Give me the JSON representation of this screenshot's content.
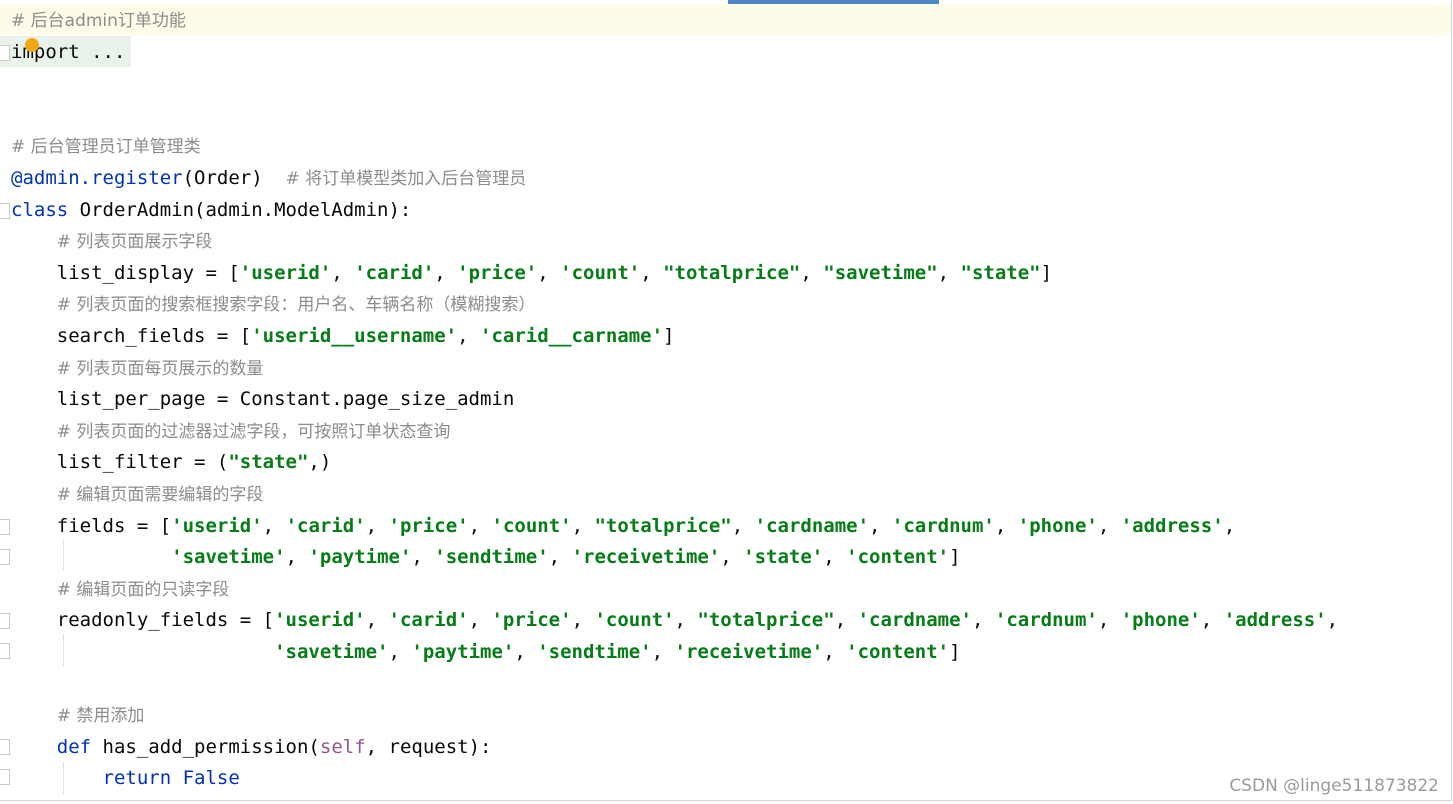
{
  "editor": {
    "lines": [
      {
        "segments": [
          {
            "t": "# 后台admin订单功能",
            "c": "cm-cjk"
          }
        ]
      },
      {
        "segments": [
          {
            "t": "import ...",
            "c": ""
          }
        ]
      },
      {
        "segments": []
      },
      {
        "segments": []
      },
      {
        "segments": [
          {
            "t": "# 后台管理员订单管理类",
            "c": "cm-cjk"
          }
        ]
      },
      {
        "segments": [
          {
            "t": "@admin.register",
            "c": "deco"
          },
          {
            "t": "(Order)  ",
            "c": ""
          },
          {
            "t": "# 将订单模型类加入后台管理员",
            "c": "cm-cjk"
          }
        ]
      },
      {
        "segments": [
          {
            "t": "class",
            "c": "kw"
          },
          {
            "t": " OrderAdmin(admin.ModelAdmin):",
            "c": ""
          }
        ]
      },
      {
        "segments": [
          {
            "t": "    ",
            "c": ""
          },
          {
            "t": "# 列表页面展示字段",
            "c": "cm-cjk"
          }
        ]
      },
      {
        "segments": [
          {
            "t": "    list_display = [",
            "c": ""
          },
          {
            "t": "'userid'",
            "c": "str"
          },
          {
            "t": ", ",
            "c": ""
          },
          {
            "t": "'carid'",
            "c": "str"
          },
          {
            "t": ", ",
            "c": ""
          },
          {
            "t": "'price'",
            "c": "str"
          },
          {
            "t": ", ",
            "c": ""
          },
          {
            "t": "'count'",
            "c": "str"
          },
          {
            "t": ", ",
            "c": ""
          },
          {
            "t": "\"totalprice\"",
            "c": "str"
          },
          {
            "t": ", ",
            "c": ""
          },
          {
            "t": "\"savetime\"",
            "c": "str"
          },
          {
            "t": ", ",
            "c": ""
          },
          {
            "t": "\"state\"",
            "c": "str"
          },
          {
            "t": "]",
            "c": ""
          }
        ]
      },
      {
        "segments": [
          {
            "t": "    ",
            "c": ""
          },
          {
            "t": "# 列表页面的搜索框搜索字段：用户名、车辆名称（模糊搜索）",
            "c": "cm-cjk"
          }
        ]
      },
      {
        "segments": [
          {
            "t": "    search_fields = [",
            "c": ""
          },
          {
            "t": "'userid__username'",
            "c": "str"
          },
          {
            "t": ", ",
            "c": ""
          },
          {
            "t": "'carid__carname'",
            "c": "str"
          },
          {
            "t": "]",
            "c": ""
          }
        ]
      },
      {
        "segments": [
          {
            "t": "    ",
            "c": ""
          },
          {
            "t": "# 列表页面每页展示的数量",
            "c": "cm-cjk"
          }
        ]
      },
      {
        "segments": [
          {
            "t": "    list_per_page = Constant.page_size_admin",
            "c": ""
          }
        ]
      },
      {
        "segments": [
          {
            "t": "    ",
            "c": ""
          },
          {
            "t": "# 列表页面的过滤器过滤字段，可按照订单状态查询",
            "c": "cm-cjk"
          }
        ]
      },
      {
        "segments": [
          {
            "t": "    list_filter = (",
            "c": ""
          },
          {
            "t": "\"state\"",
            "c": "str"
          },
          {
            "t": ",)",
            "c": ""
          }
        ]
      },
      {
        "segments": [
          {
            "t": "    ",
            "c": ""
          },
          {
            "t": "# 编辑页面需要编辑的字段",
            "c": "cm-cjk"
          }
        ]
      },
      {
        "segments": [
          {
            "t": "    fields = [",
            "c": ""
          },
          {
            "t": "'userid'",
            "c": "str"
          },
          {
            "t": ", ",
            "c": ""
          },
          {
            "t": "'carid'",
            "c": "str"
          },
          {
            "t": ", ",
            "c": ""
          },
          {
            "t": "'price'",
            "c": "str"
          },
          {
            "t": ", ",
            "c": ""
          },
          {
            "t": "'count'",
            "c": "str"
          },
          {
            "t": ", ",
            "c": ""
          },
          {
            "t": "\"totalprice\"",
            "c": "str"
          },
          {
            "t": ", ",
            "c": ""
          },
          {
            "t": "'cardname'",
            "c": "str"
          },
          {
            "t": ", ",
            "c": ""
          },
          {
            "t": "'cardnum'",
            "c": "str"
          },
          {
            "t": ", ",
            "c": ""
          },
          {
            "t": "'phone'",
            "c": "str"
          },
          {
            "t": ", ",
            "c": ""
          },
          {
            "t": "'address'",
            "c": "str"
          },
          {
            "t": ",",
            "c": ""
          }
        ]
      },
      {
        "segments": [
          {
            "t": "              ",
            "c": ""
          },
          {
            "t": "'savetime'",
            "c": "str"
          },
          {
            "t": ", ",
            "c": ""
          },
          {
            "t": "'paytime'",
            "c": "str"
          },
          {
            "t": ", ",
            "c": ""
          },
          {
            "t": "'sendtime'",
            "c": "str"
          },
          {
            "t": ", ",
            "c": ""
          },
          {
            "t": "'receivetime'",
            "c": "str"
          },
          {
            "t": ", ",
            "c": ""
          },
          {
            "t": "'state'",
            "c": "str"
          },
          {
            "t": ", ",
            "c": ""
          },
          {
            "t": "'content'",
            "c": "str"
          },
          {
            "t": "]",
            "c": ""
          }
        ]
      },
      {
        "segments": [
          {
            "t": "    ",
            "c": ""
          },
          {
            "t": "# 编辑页面的只读字段",
            "c": "cm-cjk"
          }
        ]
      },
      {
        "segments": [
          {
            "t": "    readonly_fields = [",
            "c": ""
          },
          {
            "t": "'userid'",
            "c": "str"
          },
          {
            "t": ", ",
            "c": ""
          },
          {
            "t": "'carid'",
            "c": "str"
          },
          {
            "t": ", ",
            "c": ""
          },
          {
            "t": "'price'",
            "c": "str"
          },
          {
            "t": ", ",
            "c": ""
          },
          {
            "t": "'count'",
            "c": "str"
          },
          {
            "t": ", ",
            "c": ""
          },
          {
            "t": "\"totalprice\"",
            "c": "str"
          },
          {
            "t": ", ",
            "c": ""
          },
          {
            "t": "'cardname'",
            "c": "str"
          },
          {
            "t": ", ",
            "c": ""
          },
          {
            "t": "'cardnum'",
            "c": "str"
          },
          {
            "t": ", ",
            "c": ""
          },
          {
            "t": "'phone'",
            "c": "str"
          },
          {
            "t": ", ",
            "c": ""
          },
          {
            "t": "'address'",
            "c": "str"
          },
          {
            "t": ",",
            "c": ""
          }
        ]
      },
      {
        "segments": [
          {
            "t": "                       ",
            "c": ""
          },
          {
            "t": "'savetime'",
            "c": "str"
          },
          {
            "t": ", ",
            "c": ""
          },
          {
            "t": "'paytime'",
            "c": "str"
          },
          {
            "t": ", ",
            "c": ""
          },
          {
            "t": "'sendtime'",
            "c": "str"
          },
          {
            "t": ", ",
            "c": ""
          },
          {
            "t": "'receivetime'",
            "c": "str"
          },
          {
            "t": ", ",
            "c": ""
          },
          {
            "t": "'content'",
            "c": "str"
          },
          {
            "t": "]",
            "c": ""
          }
        ]
      },
      {
        "segments": []
      },
      {
        "segments": [
          {
            "t": "    ",
            "c": ""
          },
          {
            "t": "# 禁用添加",
            "c": "cm-cjk"
          }
        ]
      },
      {
        "segments": [
          {
            "t": "    ",
            "c": ""
          },
          {
            "t": "def",
            "c": "kw"
          },
          {
            "t": " has_add_permission(",
            "c": ""
          },
          {
            "t": "self",
            "c": "slf"
          },
          {
            "t": ", request):",
            "c": ""
          }
        ]
      },
      {
        "segments": [
          {
            "t": "        ",
            "c": ""
          },
          {
            "t": "return",
            "c": "kw"
          },
          {
            "t": " ",
            "c": ""
          },
          {
            "t": "False",
            "c": "kw"
          }
        ]
      }
    ]
  },
  "colors": {
    "keyword": "#0033b3",
    "string": "#067d17",
    "comment": "#8c8c8c",
    "self": "#94558d",
    "current_line": "#fefbe9",
    "folded_block": "#e8f2e8",
    "scrollbar_thumb": "#4a88c7"
  },
  "icons": {
    "intention_bulb": "bulb-icon",
    "fold_marker": "fold-marker-icon"
  },
  "watermark": {
    "text": "CSDN @linge511873822"
  }
}
